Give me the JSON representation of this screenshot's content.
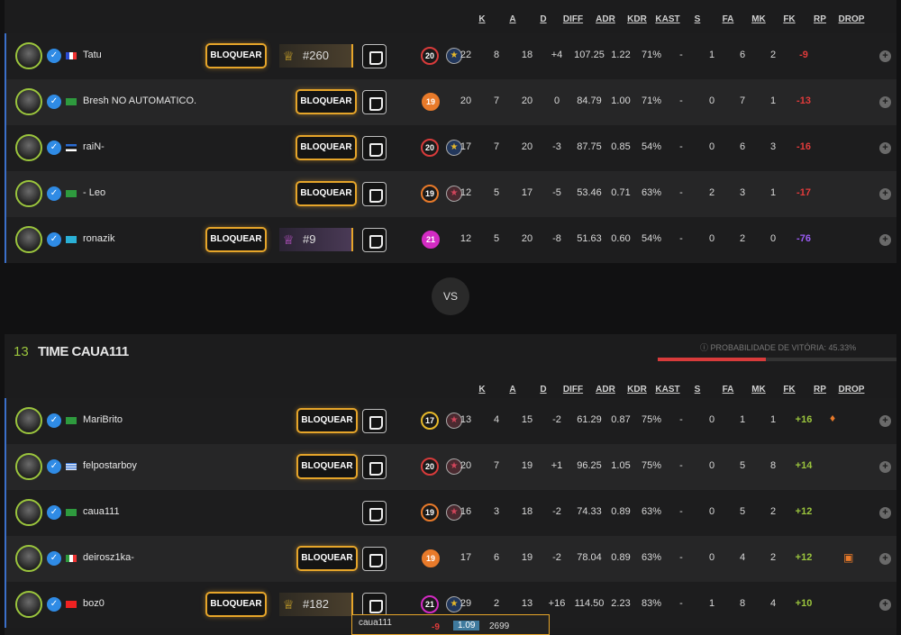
{
  "columns": [
    "K",
    "A",
    "D",
    "DIFF",
    "ADR",
    "KDR",
    "KAST",
    "S",
    "FA",
    "MK",
    "FK",
    "RP",
    "DROP"
  ],
  "team1": {
    "players": [
      {
        "name": "Tatu",
        "flag": "fr",
        "block": "BLOQUEAR",
        "rank": "#260",
        "rank_style": "gold",
        "level": "20",
        "level_color": "#d83b3b",
        "medal": "star-icon",
        "k": "22",
        "a": "8",
        "d": "18",
        "diff": "+4",
        "adr": "107.25",
        "kdr": "1.22",
        "kast": "71%",
        "s": "-",
        "fa": "1",
        "mk": "6",
        "fk": "2",
        "rp": "-9",
        "rp_color": "#e23b3b"
      },
      {
        "name": "Bresh NO AUTOMATICO.",
        "flag": "br",
        "block": "BLOQUEAR",
        "rank": "",
        "level": "19",
        "level_color": "#e87a2a",
        "medal": "",
        "k": "20",
        "a": "7",
        "d": "20",
        "diff": "0",
        "adr": "84.79",
        "kdr": "1.00",
        "kast": "71%",
        "s": "-",
        "fa": "0",
        "mk": "7",
        "fk": "1",
        "rp": "-13",
        "rp_color": "#e23b3b"
      },
      {
        "name": "raiN-",
        "flag": "ee",
        "block": "BLOQUEAR",
        "rank": "",
        "level": "20",
        "level_color": "#d83b3b",
        "medal": "star-icon",
        "k": "17",
        "a": "7",
        "d": "20",
        "diff": "-3",
        "adr": "87.75",
        "kdr": "0.85",
        "kast": "54%",
        "s": "-",
        "fa": "0",
        "mk": "6",
        "fk": "3",
        "rp": "-16",
        "rp_color": "#e23b3b"
      },
      {
        "name": "- Leo",
        "flag": "br",
        "block": "BLOQUEAR",
        "rank": "",
        "level": "19",
        "level_color": "#e87a2a",
        "medal": "pink-star-icon",
        "k": "12",
        "a": "5",
        "d": "17",
        "diff": "-5",
        "adr": "53.46",
        "kdr": "0.71",
        "kast": "63%",
        "s": "-",
        "fa": "2",
        "mk": "3",
        "fk": "1",
        "rp": "-17",
        "rp_color": "#e23b3b"
      },
      {
        "name": "ronazik",
        "flag": "kz",
        "block": "BLOQUEAR",
        "rank": "#9",
        "rank_style": "purple",
        "level": "21",
        "level_color": "#d32bc3",
        "medal": "",
        "k": "12",
        "a": "5",
        "d": "20",
        "diff": "-8",
        "adr": "51.63",
        "kdr": "0.60",
        "kast": "54%",
        "s": "-",
        "fa": "0",
        "mk": "2",
        "fk": "0",
        "rp": "-76",
        "rp_color": "#9b5cf5"
      }
    ]
  },
  "vs_label": "VS",
  "team2": {
    "score": "13",
    "name": "TIME CAUA111",
    "probability_label": "PROBABILIDADE DE VITÓRIA: 45.33%",
    "probability": 0.4533,
    "players": [
      {
        "name": "MariBrito",
        "flag": "br",
        "block": "BLOQUEAR",
        "rank": "",
        "level": "17",
        "level_color": "#e6b82a",
        "medal": "pink-star-icon",
        "k": "13",
        "a": "4",
        "d": "15",
        "diff": "-2",
        "adr": "61.29",
        "kdr": "0.87",
        "kast": "75%",
        "s": "-",
        "fa": "0",
        "mk": "1",
        "fk": "1",
        "rp": "+16",
        "rp_color": "#9bc53d",
        "drop": "ticket-icon"
      },
      {
        "name": "felpostarboy",
        "flag": "gr",
        "block": "BLOQUEAR",
        "rank": "",
        "level": "20",
        "level_color": "#d83b3b",
        "medal": "pink-star-icon",
        "k": "20",
        "a": "7",
        "d": "19",
        "diff": "+1",
        "adr": "96.25",
        "kdr": "1.05",
        "kast": "75%",
        "s": "-",
        "fa": "0",
        "mk": "5",
        "fk": "8",
        "rp": "+14",
        "rp_color": "#9bc53d"
      },
      {
        "name": "caua111",
        "flag": "br",
        "block": "",
        "rank": "",
        "level": "19",
        "level_color": "#e87a2a",
        "medal": "pink-star-icon",
        "k": "16",
        "a": "3",
        "d": "18",
        "diff": "-2",
        "adr": "74.33",
        "kdr": "0.89",
        "kast": "63%",
        "s": "-",
        "fa": "0",
        "mk": "5",
        "fk": "2",
        "rp": "+12",
        "rp_color": "#9bc53d"
      },
      {
        "name": "deirosz1ka-",
        "flag": "it",
        "block": "BLOQUEAR",
        "rank": "",
        "level": "19",
        "level_color": "#e87a2a",
        "medal": "",
        "k": "17",
        "a": "6",
        "d": "19",
        "diff": "-2",
        "adr": "78.04",
        "kdr": "0.89",
        "kast": "63%",
        "s": "-",
        "fa": "0",
        "mk": "4",
        "fk": "2",
        "rp": "+12",
        "rp_color": "#9bc53d",
        "drop": "case-icon"
      },
      {
        "name": "boz0",
        "flag": "tr",
        "block": "BLOQUEAR",
        "rank": "#182",
        "rank_style": "gold",
        "level": "21",
        "level_color": "#d32bc3",
        "medal": "star-icon",
        "k": "29",
        "a": "2",
        "d": "13",
        "diff": "+16",
        "adr": "114.50",
        "kdr": "2.23",
        "kast": "83%",
        "s": "-",
        "fa": "1",
        "mk": "8",
        "fk": "4",
        "rp": "+10",
        "rp_color": "#9bc53d"
      }
    ]
  },
  "tooltip": {
    "name": "caua111",
    "rp": "-9",
    "kdr": "1.09",
    "elo": "2699"
  }
}
